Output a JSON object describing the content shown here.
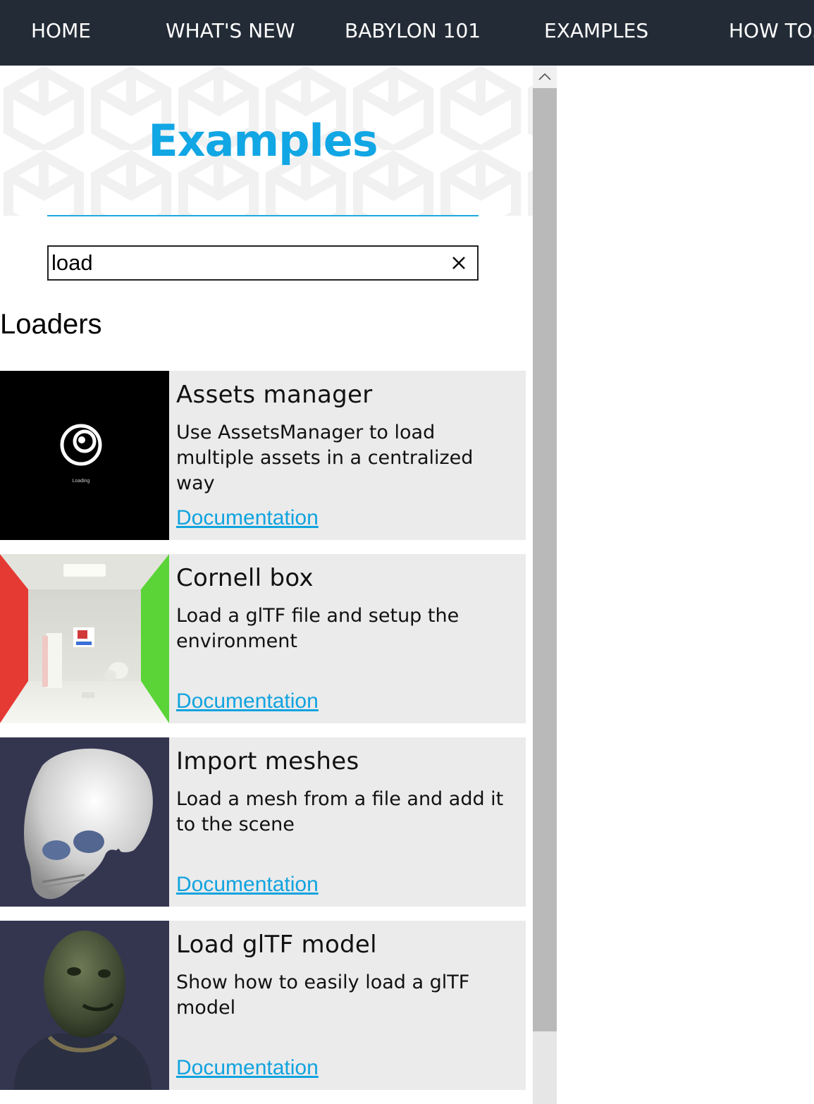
{
  "nav": {
    "items": [
      {
        "label": "HOME"
      },
      {
        "label": "WHAT'S NEW"
      },
      {
        "label": "BABYLON 101"
      },
      {
        "label": "EXAMPLES"
      },
      {
        "label": "HOW TO."
      }
    ]
  },
  "page": {
    "title": "Examples"
  },
  "search": {
    "value": "load",
    "clear_icon": "close-icon"
  },
  "section": {
    "title": "Loaders"
  },
  "cards": [
    {
      "title": "Assets manager",
      "description": "Use AssetsManager to load multiple assets in a centralized way",
      "link": "Documentation",
      "thumb_caption": "Loading"
    },
    {
      "title": "Cornell box",
      "description": "Load a glTF file and setup the environment",
      "link": "Documentation"
    },
    {
      "title": "Import meshes",
      "description": "Load a mesh from a file and add it to the scene",
      "link": "Documentation"
    },
    {
      "title": "Load glTF model",
      "description": "Show how to easily load a glTF model",
      "link": "Documentation"
    }
  ],
  "colors": {
    "nav_bg": "#232b36",
    "accent": "#11a6e4",
    "card_bg": "#ebebeb",
    "scroll_thumb": "#b9b9b9"
  }
}
